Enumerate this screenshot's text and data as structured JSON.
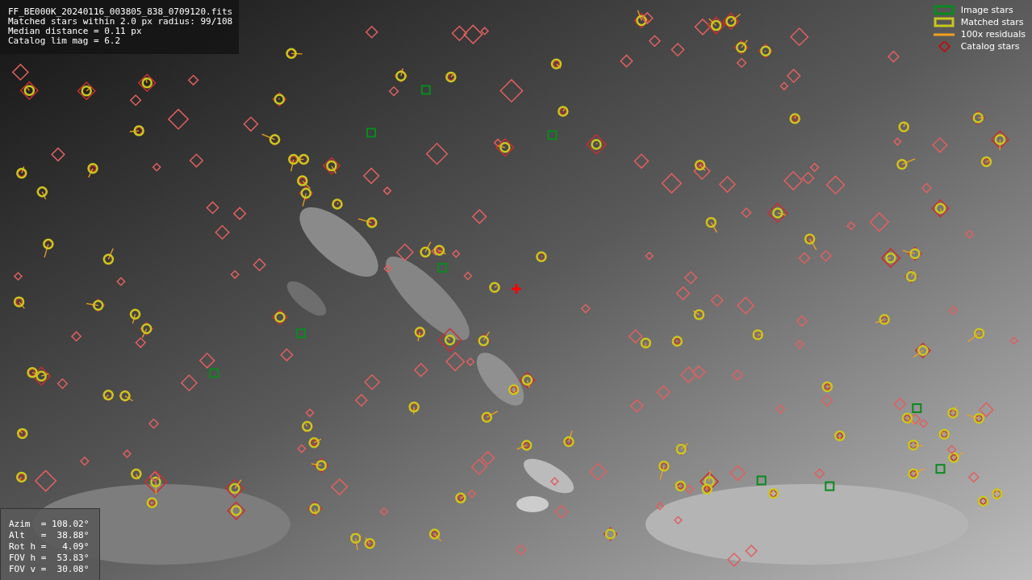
{
  "info_box": {
    "lines": [
      "FF_BE000K_20240116_003805_838_0709120.fits",
      "Matched stars within 2.0 px radius: 99/108",
      "Median distance = 0.11 px",
      "Catalog lim mag = 6.2"
    ]
  },
  "legend": [
    {
      "kind": "box",
      "label": "Image stars",
      "color": "#0a8a1e"
    },
    {
      "kind": "box",
      "label": "Matched stars",
      "color": "#c8c81e"
    },
    {
      "kind": "line",
      "label": "100x residuals",
      "color": "#f0a020"
    },
    {
      "kind": "diamond",
      "label": "Catalog stars",
      "color": "#b01818"
    }
  ],
  "pointing_box": {
    "lines": [
      "Azim  = 108.02°",
      "Alt   =  38.88°",
      "Rot h =   4.09°",
      "FOV h =  53.83°",
      "FOV v =  30.08°"
    ]
  }
}
